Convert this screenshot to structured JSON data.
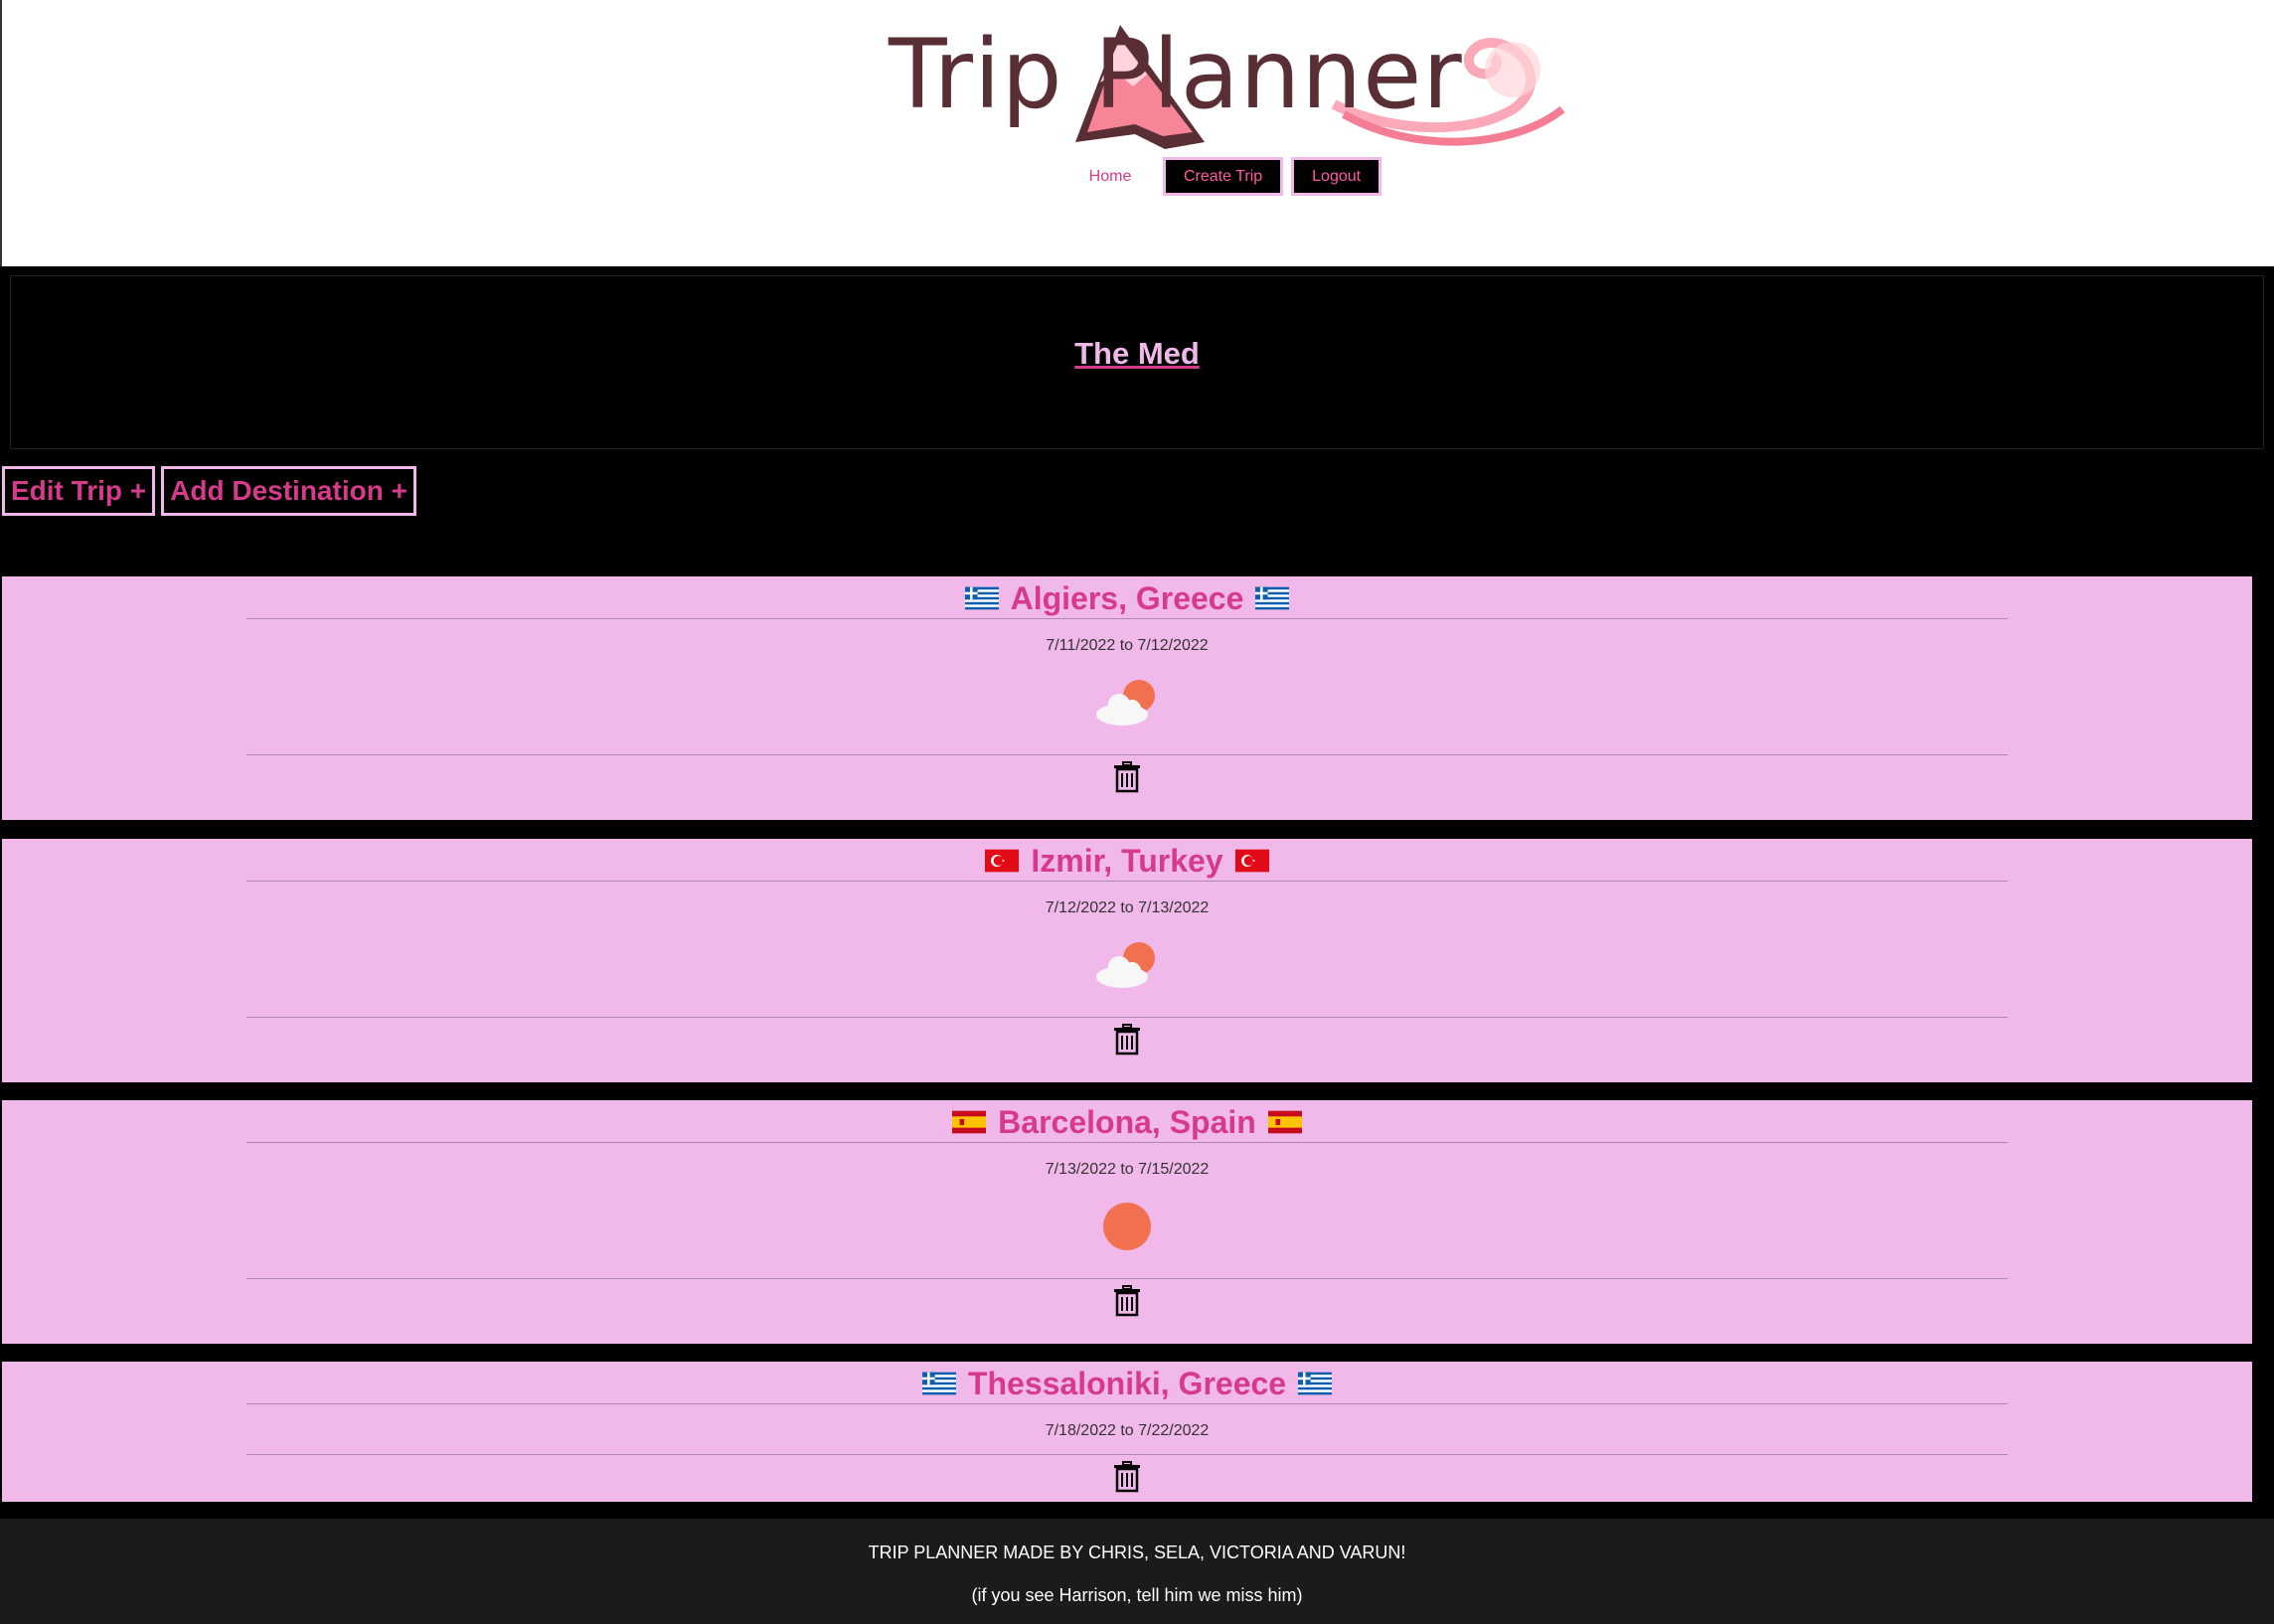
{
  "header": {
    "logo_text": "Trip Planner",
    "nav": {
      "home": "Home",
      "create_trip": "Create Trip",
      "logout": "Logout"
    }
  },
  "trip": {
    "title": "The Med",
    "edit_label": "Edit Trip +",
    "add_label": "Add Destination +"
  },
  "destinations": [
    {
      "name": "Algiers, Greece",
      "flag": "greece-flag-icon",
      "dates": "7/11/2022 to 7/12/2022",
      "weather": "partly-cloudy-icon"
    },
    {
      "name": "Izmir, Turkey",
      "flag": "turkey-flag-icon",
      "dates": "7/12/2022 to 7/13/2022",
      "weather": "partly-cloudy-icon"
    },
    {
      "name": "Barcelona, Spain",
      "flag": "spain-flag-icon",
      "dates": "7/13/2022 to 7/15/2022",
      "weather": "sun-icon"
    },
    {
      "name": "Thessaloniki, Greece",
      "flag": "greece-flag-icon",
      "dates": "7/18/2022 to 7/22/2022",
      "weather": ""
    }
  ],
  "footer": {
    "credits": "TRIP PLANNER MADE BY CHRIS, SELA, VICTORIA AND VARUN!",
    "note": "(if you see Harrison, tell him we miss him)"
  },
  "colors": {
    "accent": "#d63a8a",
    "card": "#f1b8ea",
    "logo": "#5a2e35"
  }
}
